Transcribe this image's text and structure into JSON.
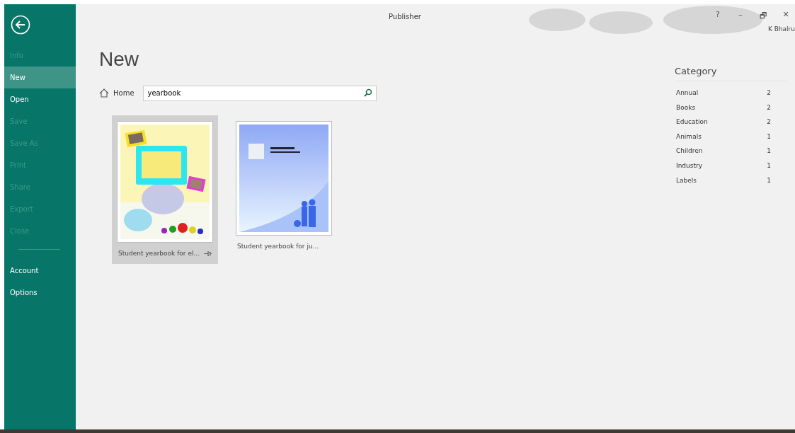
{
  "window": {
    "title": "Publisher",
    "user": "K Bhalru",
    "controls": [
      "?",
      "–",
      "🗗",
      "✕"
    ]
  },
  "sidebar": {
    "items": [
      {
        "label": "Info",
        "selected": false,
        "disabled": true
      },
      {
        "label": "New",
        "selected": true,
        "disabled": false
      },
      {
        "label": "Open",
        "selected": false,
        "disabled": false
      },
      {
        "label": "Save",
        "selected": false,
        "disabled": true
      },
      {
        "label": "Save As",
        "selected": false,
        "disabled": true
      },
      {
        "label": "Print",
        "selected": false,
        "disabled": true
      },
      {
        "label": "Share",
        "selected": false,
        "disabled": true
      },
      {
        "label": "Export",
        "selected": false,
        "disabled": true
      },
      {
        "label": "Close",
        "selected": false,
        "disabled": true
      }
    ],
    "bottom_items": [
      {
        "label": "Account"
      },
      {
        "label": "Options"
      }
    ]
  },
  "page_title": "New",
  "home_link": "Home",
  "search": {
    "value": "yearbook"
  },
  "templates": [
    {
      "kind": "elementary",
      "name": "Student yearbook for el...",
      "selected": true
    },
    {
      "kind": "junior",
      "name": "Student yearbook for ju...",
      "selected": false
    }
  ],
  "category": {
    "title": "Category",
    "items": [
      {
        "name": "Annual",
        "count": "2"
      },
      {
        "name": "Books",
        "count": "2"
      },
      {
        "name": "Education",
        "count": "2"
      },
      {
        "name": "Animals",
        "count": "1"
      },
      {
        "name": "Children",
        "count": "1"
      },
      {
        "name": "Industry",
        "count": "1"
      },
      {
        "name": "Labels",
        "count": "1"
      }
    ]
  }
}
